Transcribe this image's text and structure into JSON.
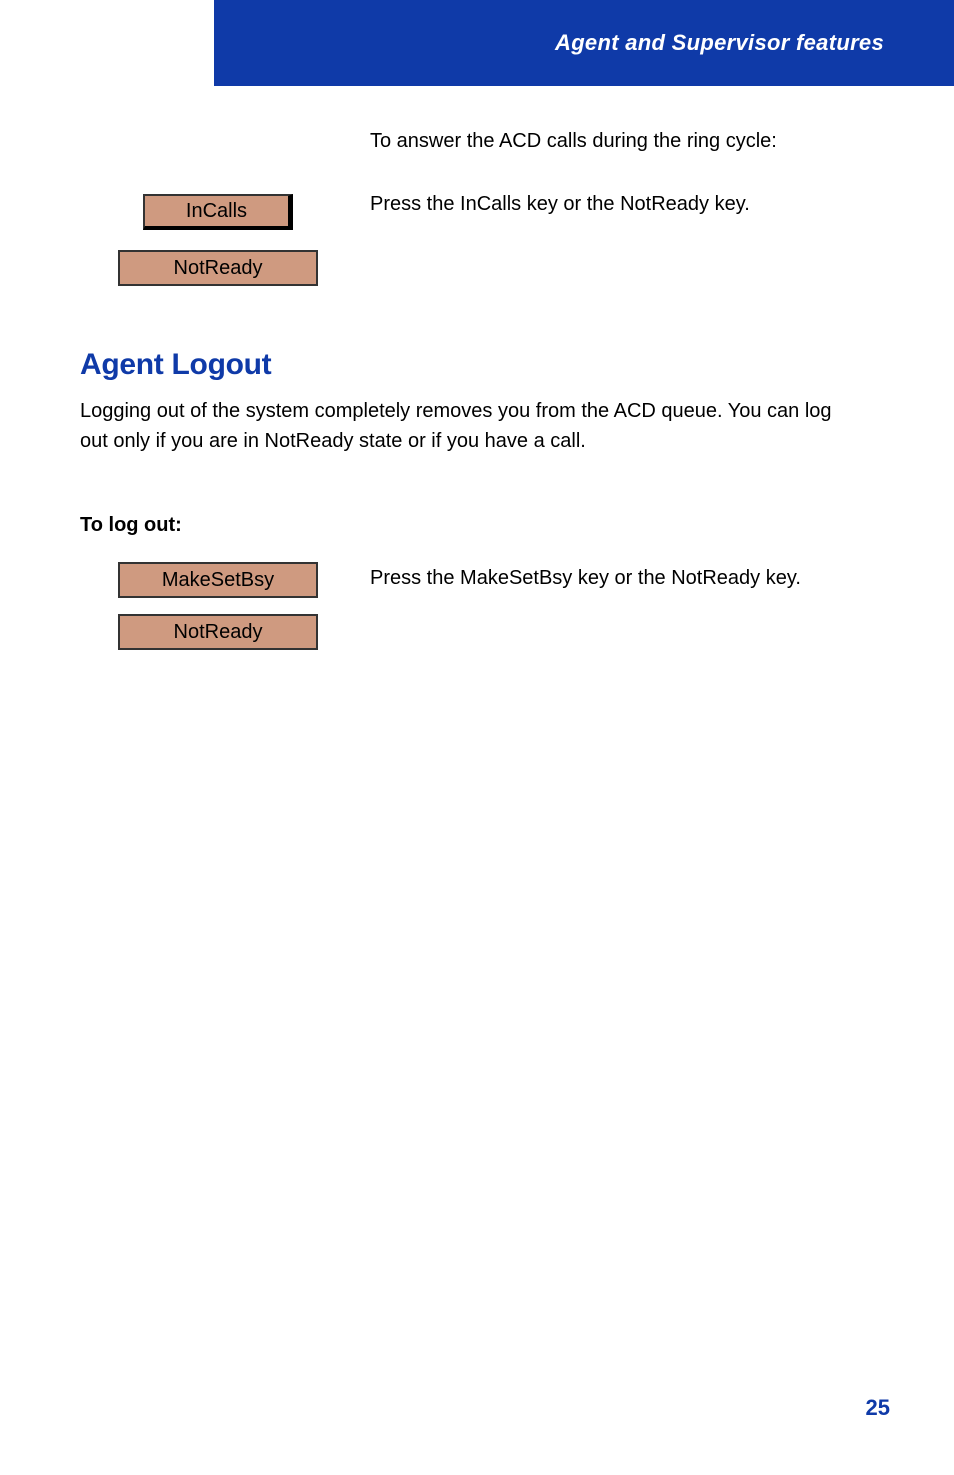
{
  "header": {
    "title": "Agent and Supervisor features"
  },
  "answer_section": {
    "intro": "To answer the ACD calls during the ring cycle:",
    "button_incalls": "InCalls",
    "button_notready": "NotReady",
    "step_text": "Press the InCalls key or the NotReady key."
  },
  "logout_section": {
    "title": "Agent Logout",
    "intro": "Logging out of the system completely removes you from the ACD queue. You can log out only if you are in NotReady state or if you have a call.",
    "sub": "To log out:",
    "button_msb": "MakeSetBsy",
    "button_notready": "NotReady",
    "step_text": "Press the MakeSetBsy key or the NotReady key."
  },
  "page_number": "25"
}
